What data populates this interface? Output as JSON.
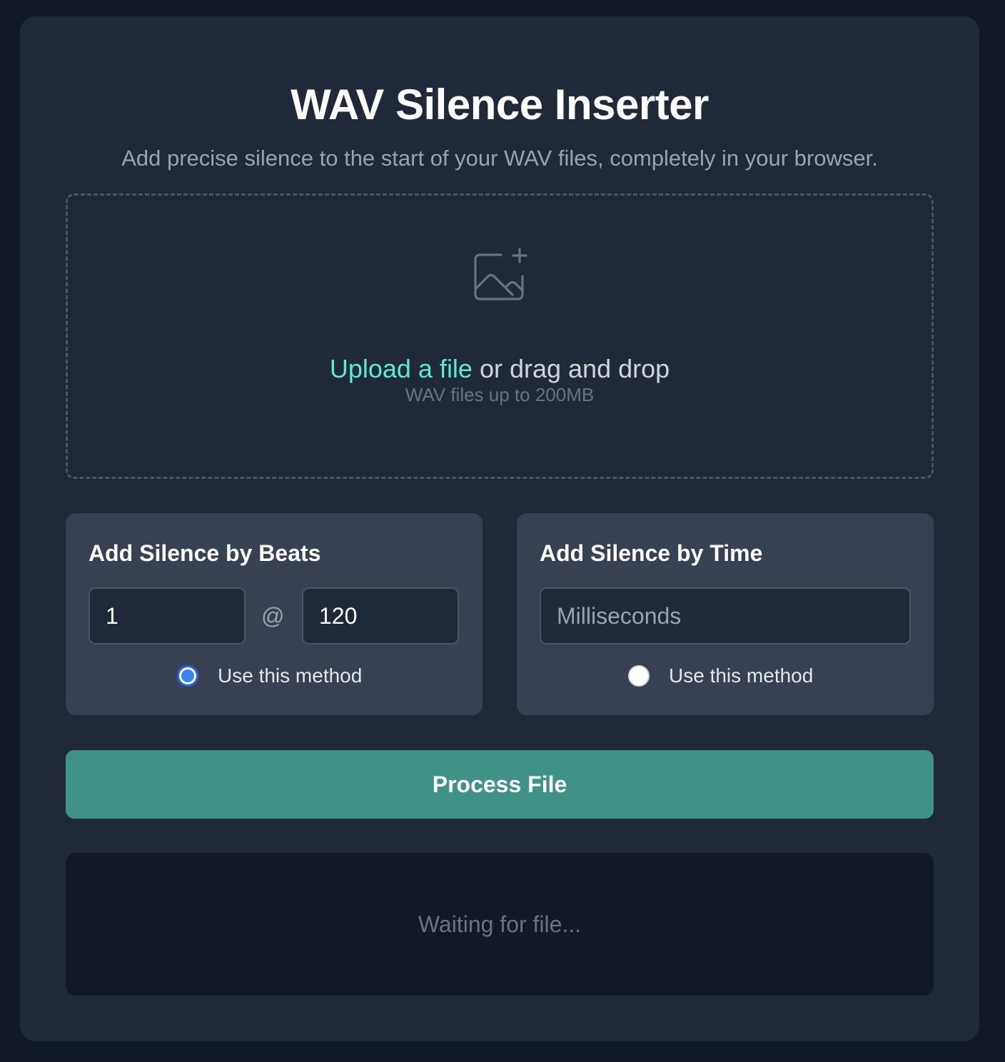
{
  "app": {
    "title": "WAV Silence Inserter",
    "subtitle": "Add precise silence to the start of your WAV files, completely in your browser."
  },
  "upload": {
    "icon": "image-plus-icon",
    "link_text": "Upload a file",
    "rest_text": " or drag and drop",
    "hint": "WAV files up to 200MB"
  },
  "beats_panel": {
    "title": "Add Silence by Beats",
    "beats_value": "1",
    "separator": "@",
    "bpm_value": "120",
    "radio_label": "Use this method",
    "selected": true
  },
  "time_panel": {
    "title": "Add Silence by Time",
    "ms_value": "",
    "ms_placeholder": "Milliseconds",
    "radio_label": "Use this method",
    "selected": false
  },
  "process_button": {
    "label": "Process File"
  },
  "status": {
    "text": "Waiting for file..."
  },
  "colors": {
    "background": "#111827",
    "card": "#1f2937",
    "panel": "#374151",
    "accent_link": "#5eead4",
    "process_button": "#419286",
    "radio_checked": "#3b82f6"
  }
}
